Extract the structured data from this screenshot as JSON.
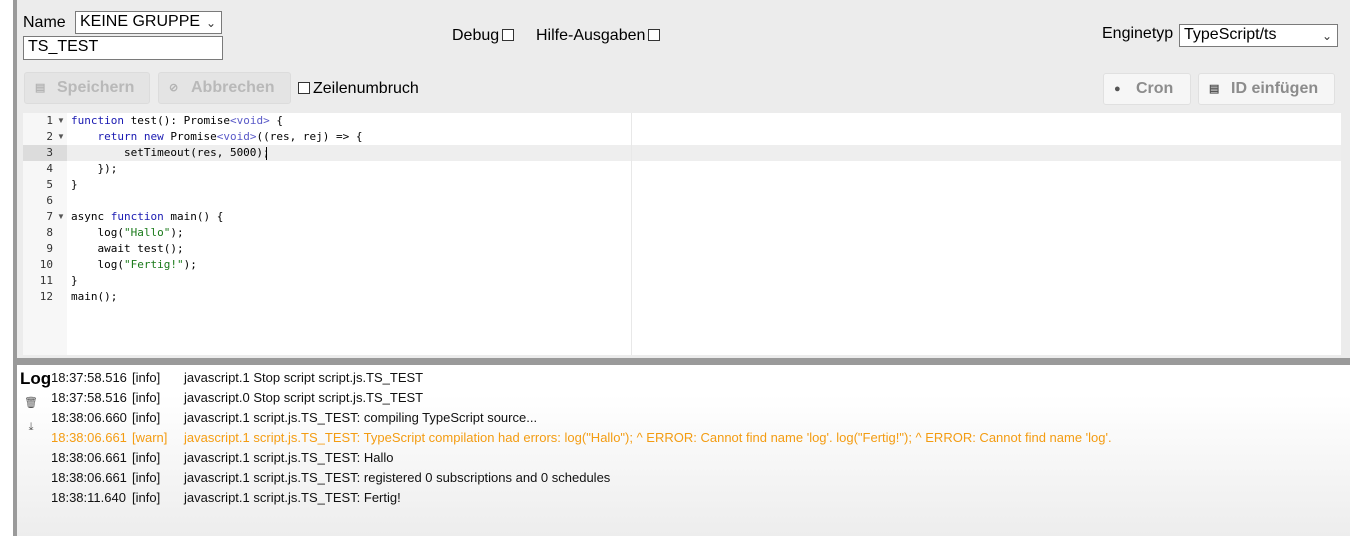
{
  "header": {
    "name_label": "Name",
    "group_select": "KEINE GRUPPE",
    "script_name_value": "TS_TEST",
    "debug_label": "Debug",
    "help_output_label": "Hilfe-Ausgaben",
    "engine_label": "Enginetyp",
    "engine_select": "TypeScript/ts"
  },
  "toolbar": {
    "save_label": "Speichern",
    "cancel_label": "Abbrechen",
    "wrap_label": "Zeilenumbruch",
    "cron_label": "Cron",
    "insert_id_label": "ID einfügen"
  },
  "editor": {
    "active_line": 3,
    "line_numbers": [
      "1",
      "2",
      "3",
      "4",
      "5",
      "6",
      "7",
      "8",
      "9",
      "10",
      "11",
      "12"
    ],
    "lines": [
      "function test(): Promise<void> {",
      "    return new Promise<void>((res, rej) => {",
      "        setTimeout(res, 5000);",
      "    });",
      "}",
      "",
      "async function main() {",
      "    log(\"Hallo\");",
      "    await test();",
      "    log(\"Fertig!\");",
      "}",
      "main();"
    ]
  },
  "log": {
    "title": "Log",
    "rows": [
      {
        "time": "18:37:58.516",
        "severity": "[info]",
        "message": "javascript.1 Stop script script.js.TS_TEST"
      },
      {
        "time": "18:37:58.516",
        "severity": "[info]",
        "message": "javascript.0 Stop script script.js.TS_TEST"
      },
      {
        "time": "18:38:06.660",
        "severity": "[info]",
        "message": "javascript.1 script.js.TS_TEST: compiling TypeScript source..."
      },
      {
        "time": "18:38:06.661",
        "severity": "[warn]",
        "message": "javascript.1 script.js.TS_TEST: TypeScript compilation had errors: log(\"Hallo\"); ^ ERROR: Cannot find name 'log'. log(\"Fertig!\"); ^ ERROR: Cannot find name 'log'."
      },
      {
        "time": "18:38:06.661",
        "severity": "[info]",
        "message": "javascript.1 script.js.TS_TEST: Hallo"
      },
      {
        "time": "18:38:06.661",
        "severity": "[info]",
        "message": "javascript.1 script.js.TS_TEST: registered 0 subscriptions and 0 schedules"
      },
      {
        "time": "18:38:11.640",
        "severity": "[info]",
        "message": "javascript.1 script.js.TS_TEST: Fertig!"
      }
    ]
  },
  "icons": {
    "save": "save-icon",
    "cancel": "cancel-icon",
    "cron": "clock-icon",
    "insert_id": "list-icon",
    "clear_log": "trash-icon",
    "download_log": "download-icon"
  },
  "colors": {
    "warn": "#f39c12",
    "keyword": "#1a1ab2",
    "string": "#1a7a1a"
  }
}
